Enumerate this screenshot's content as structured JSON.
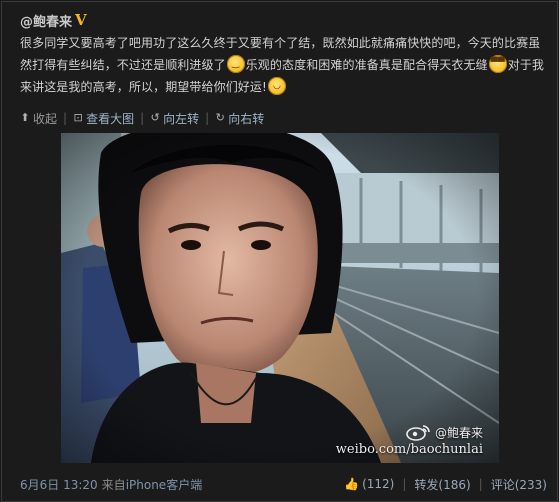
{
  "post": {
    "author": "@鲍春来",
    "verified_badge": "V",
    "text": {
      "seg1": "很多同学又要高考了吧用功了这么久终于又要有个了结，既然如此就痛痛快快的吧，今天的比赛虽然打得有些纠结，不过还是顺利进级了",
      "seg2": "乐观的态度和困难的准备真是配合得天衣无缝",
      "seg3": "对于我来讲这是我的高考，所以，期望带给你们好运!",
      "emojis": [
        "neutral-face-emoji",
        "grin-emoji",
        "laugh-emoji"
      ]
    }
  },
  "actions": {
    "collapse": "收起",
    "view_large": "查看大图",
    "rotate_left": "向左转",
    "rotate_right": "向右转"
  },
  "photo": {
    "watermark_name": "@鲍春来",
    "watermark_url": "weibo.com/baochunlai"
  },
  "footer": {
    "date": "6月6日 13:20",
    "source_prefix": "来自",
    "source": "iPhone客户端",
    "likes": "(112)",
    "repost": "转发(186)",
    "comment": "评论(233)"
  },
  "colors": {
    "background": "#1b1b1b",
    "text": "#d2d2d2",
    "link": "#9fb4c9",
    "verified": "#f1b42f"
  }
}
